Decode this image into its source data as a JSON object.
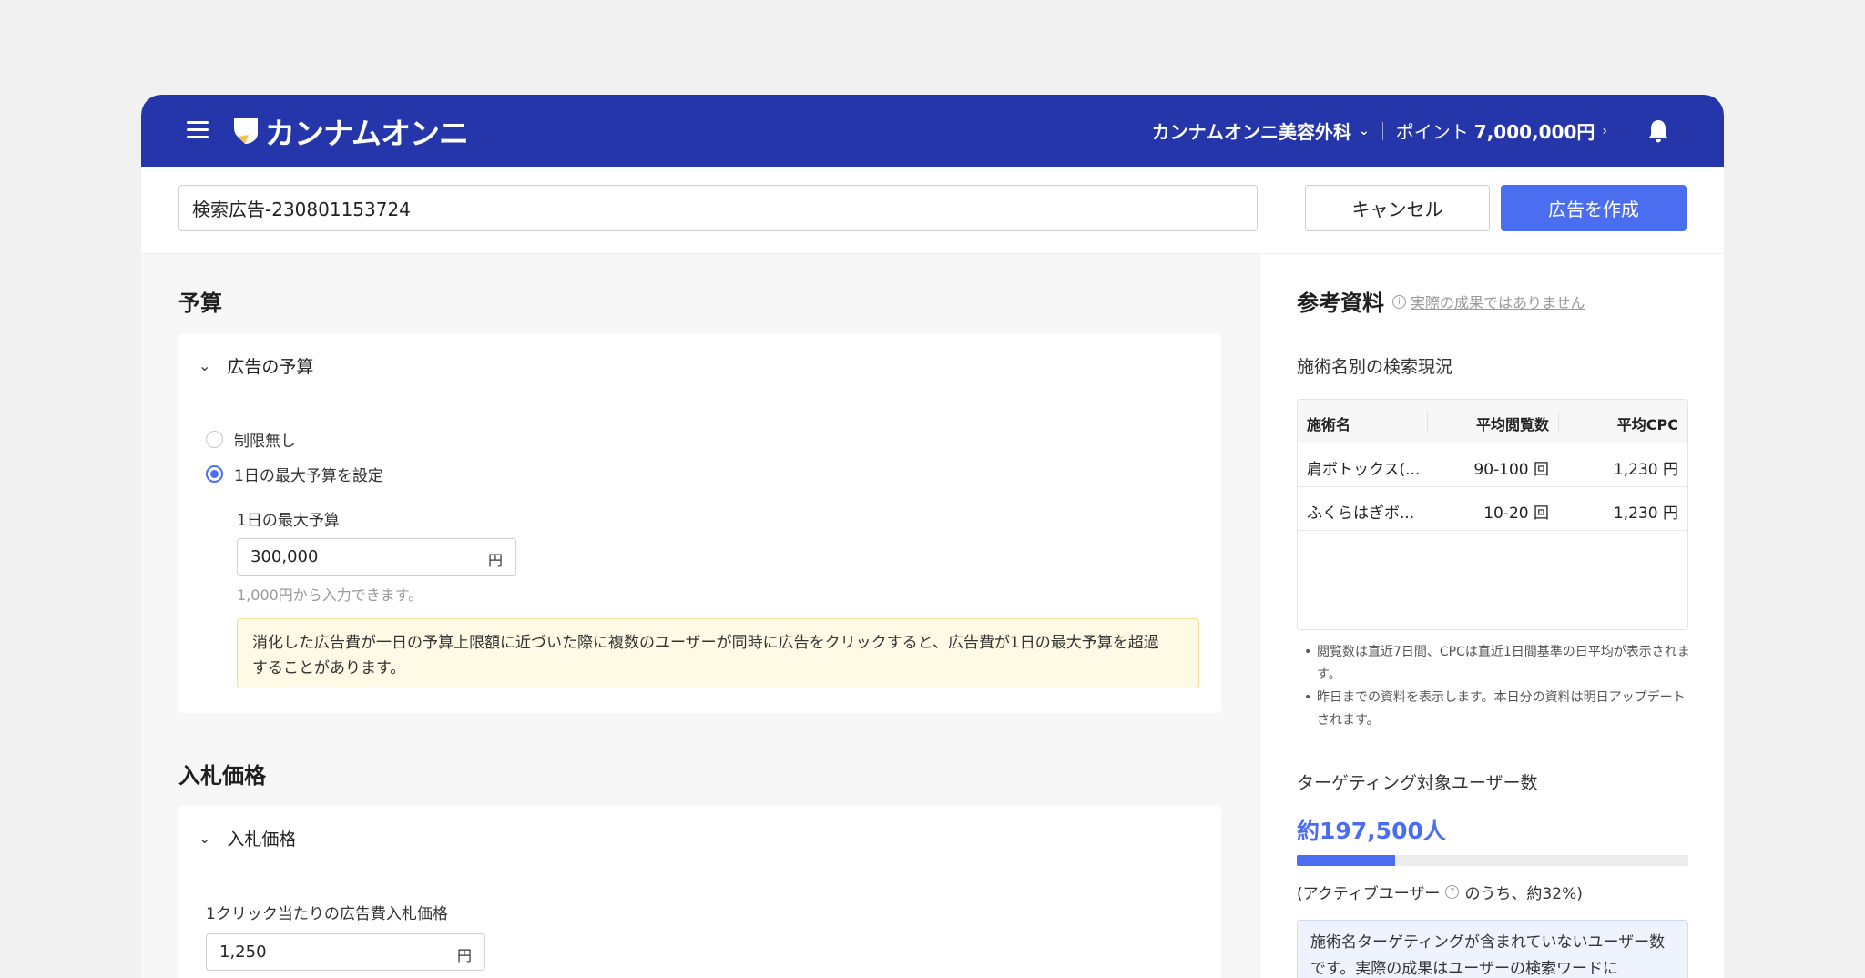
{
  "header": {
    "logo_text": "カンナムオンニ",
    "clinic_name": "カンナムオンニ美容外科",
    "points_label": "ポイント",
    "points_value": "7,000,000円"
  },
  "ad_name": {
    "value": "検索広告-230801153724"
  },
  "actions": {
    "cancel_label": "キャンセル",
    "create_label": "広告を作成"
  },
  "budget": {
    "section_title": "予算",
    "card_title": "広告の予算",
    "option_unlimited": "制限無し",
    "option_daily": "1日の最大予算を設定",
    "selected": "daily",
    "daily_label": "1日の最大予算",
    "daily_value": "300,000",
    "unit": "円",
    "hint": "1,000円から入力できます。",
    "notice_line1": "消化した広告費が一日の予算上限額に近づいた際に複数のユーザーが同時に広告をクリックすると、広告費が1日の最大予算を超過",
    "notice_line2": "することがあります。"
  },
  "bid": {
    "section_title": "入札価格",
    "card_title": "入札価格",
    "field_label": "1クリック当たりの広告費入札価格",
    "value": "1,250",
    "unit": "円"
  },
  "reference": {
    "title": "参考資料",
    "note": "実際の成果ではありません",
    "search_status_title": "施術名別の検索現況",
    "table_headers": [
      "施術名",
      "平均閲覧数",
      "平均CPC"
    ],
    "table_rows": [
      [
        "肩ボトックス(...",
        "90-100 回",
        "1,230 円"
      ],
      [
        "ふくらはぎボ...",
        "10-20 回",
        "1,230 円"
      ]
    ],
    "bullets": [
      "閲覧数は直近7日間、CPCは直近1日間基準の日平均が表示されます。",
      "昨日までの資料を表示します。本日分の資料は明日アップデートされます。"
    ],
    "targeting_title": "ターゲティング対象ユーザー数",
    "targeting_count": "約197,500人",
    "targeting_ratio": 0.25,
    "active_prefix": "(アクティブユーザー",
    "active_suffix": "のうち、約32%)",
    "info_box": "施術名ターゲティングが含まれていないユーザー数です。実際の成果はユーザーの検索ワードに"
  },
  "colors": {
    "brand": "#2436a9",
    "accent": "#4b6ef0"
  }
}
